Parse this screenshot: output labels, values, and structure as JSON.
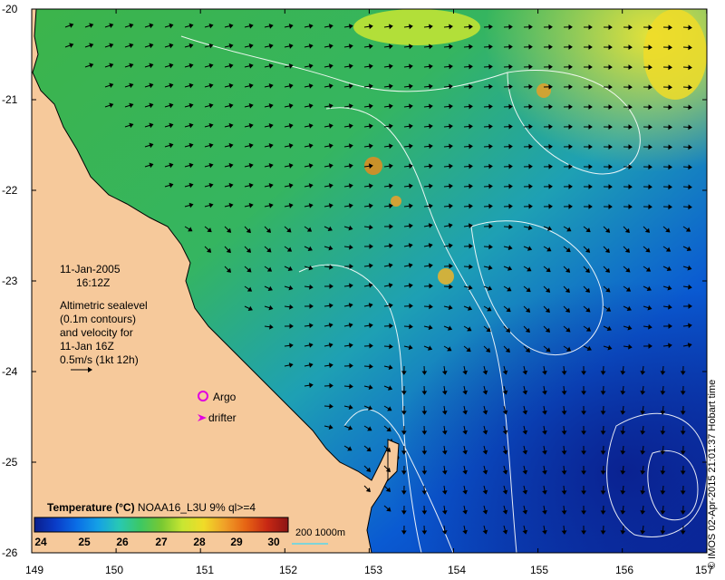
{
  "map": {
    "lat_ticks": [
      "-20",
      "-21",
      "-22",
      "-23",
      "-24",
      "-25",
      "-26"
    ],
    "lon_ticks": [
      "149",
      "150",
      "151",
      "152",
      "153",
      "154",
      "155",
      "156",
      "157"
    ],
    "land_color": "#f6c99b",
    "coast_color": "#000000"
  },
  "annotation": {
    "date": "11-Jan-2005",
    "time": "16:12Z",
    "desc_1": "Altimetric sealevel",
    "desc_2": "(0.1m contours)",
    "desc_3": "and velocity for",
    "desc_4": "11-Jan 16Z",
    "desc_5": "0.5m/s  (1kt 12h)"
  },
  "legend": {
    "argo": "Argo",
    "drifter": "drifter",
    "argo_color": "#e000e0",
    "drifter_color": "#e000e0"
  },
  "colorbar": {
    "title_bold": "Temperature (°C)",
    "title_rest": " NOAA16_L3U 9% ql>=4",
    "ticks": [
      "24",
      "25",
      "26",
      "27",
      "28",
      "29",
      "30"
    ],
    "colors": [
      "#0a1e8c",
      "#0a3cc8",
      "#0a6ee6",
      "#14a0e6",
      "#28c8b4",
      "#3cc864",
      "#78c832",
      "#c8e632",
      "#f0dc28",
      "#f0a028",
      "#e66414",
      "#c82814",
      "#8c1414"
    ]
  },
  "contour_key": "200  1000m",
  "credit": "© IMOS 02-Apr-2015 21:01:37 Hobart time"
}
